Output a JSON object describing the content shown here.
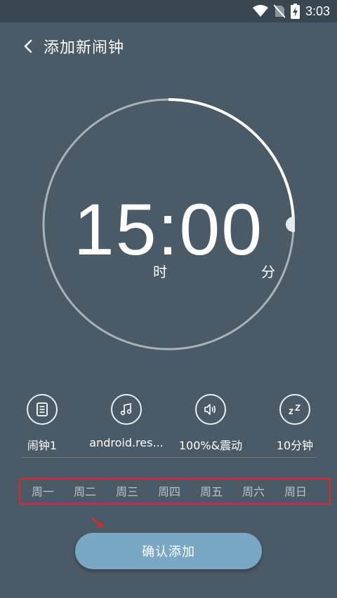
{
  "status_bar": {
    "time": "3:03"
  },
  "header": {
    "title": "添加新闹钟"
  },
  "clock": {
    "time": "15:00",
    "hour_unit": "时",
    "minute_unit": "分",
    "minute_fraction": 0.0
  },
  "options": [
    {
      "icon": "note-list-icon",
      "label": "闹钟1"
    },
    {
      "icon": "music-note-icon",
      "label": "android.res..."
    },
    {
      "icon": "volume-icon",
      "label": "100%&震动"
    },
    {
      "icon": "snooze-icon",
      "label": "10分钟"
    }
  ],
  "weekdays": [
    "周一",
    "周二",
    "周三",
    "周四",
    "周五",
    "周六",
    "周日"
  ],
  "confirm_button": {
    "label": "确认添加"
  },
  "colors": {
    "background": "#4a5a66",
    "status_bar": "#3a4650",
    "button": "#7aa8c4",
    "highlight_box": "#e0262b",
    "arc_active": "#ffffff",
    "arc_track": "#a9b2b8"
  }
}
